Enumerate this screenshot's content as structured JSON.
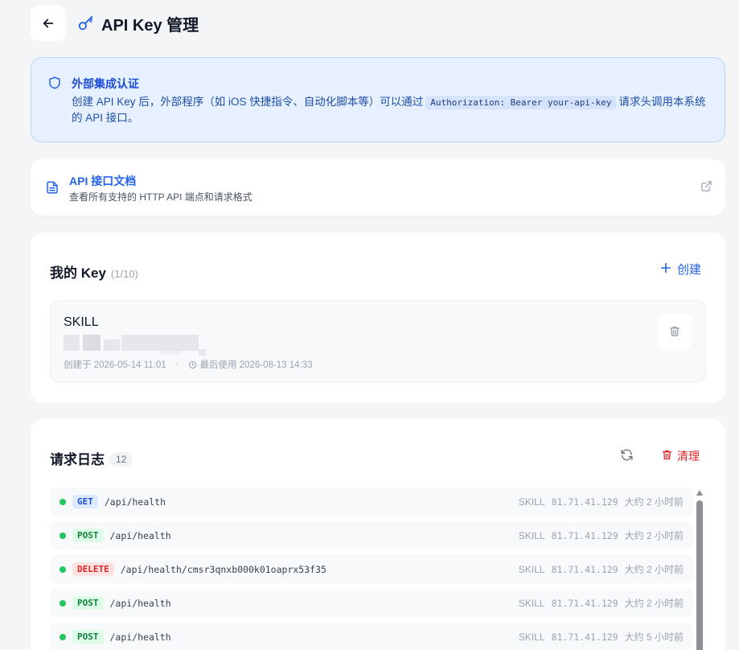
{
  "header": {
    "title": "API Key 管理",
    "back_icon": "arrow-left-icon",
    "key_icon": "key-icon"
  },
  "info": {
    "title": "外部集成认证",
    "text_before": "创建 API Key 后，外部程序（如 iOS 快捷指令、自动化脚本等）可以通过",
    "code": "Authorization: Bearer your-api-key",
    "text_after": "请求头调用本系统的 API 接口。",
    "icon": "shield-icon"
  },
  "docs": {
    "title": "API 接口文档",
    "subtitle": "查看所有支持的 HTTP API 端点和请求格式",
    "icon": "document-icon",
    "link_icon": "external-link-icon"
  },
  "keys": {
    "title": "我的 Key",
    "count": "(1/10)",
    "create_label": "创建",
    "items": [
      {
        "name": "SKILL",
        "created": "创建于 2026-05-14 11:01",
        "separator": "·",
        "last_used": "最后使用 2026-08-13 14:33"
      }
    ]
  },
  "logs": {
    "title": "请求日志",
    "count": "12",
    "clear_label": "清理",
    "rows": [
      {
        "method": "GET",
        "path": "/api/health",
        "key": "SKILL",
        "ip": "81.71.41.129",
        "time": "大约 2 小时前"
      },
      {
        "method": "POST",
        "path": "/api/health",
        "key": "SKILL",
        "ip": "81.71.41.129",
        "time": "大约 2 小时前"
      },
      {
        "method": "DELETE",
        "path": "/api/health/cmsr3qnxb000k01oaprx53f35",
        "key": "SKILL",
        "ip": "81.71.41.129",
        "time": "大约 2 小时前"
      },
      {
        "method": "POST",
        "path": "/api/health",
        "key": "SKILL",
        "ip": "81.71.41.129",
        "time": "大约 2 小时前"
      },
      {
        "method": "POST",
        "path": "/api/health",
        "key": "SKILL",
        "ip": "81.71.41.129",
        "time": "大约 5 小时前"
      }
    ]
  },
  "colors": {
    "accent": "#2563eb",
    "danger": "#dc2626",
    "success": "#22c55e"
  }
}
